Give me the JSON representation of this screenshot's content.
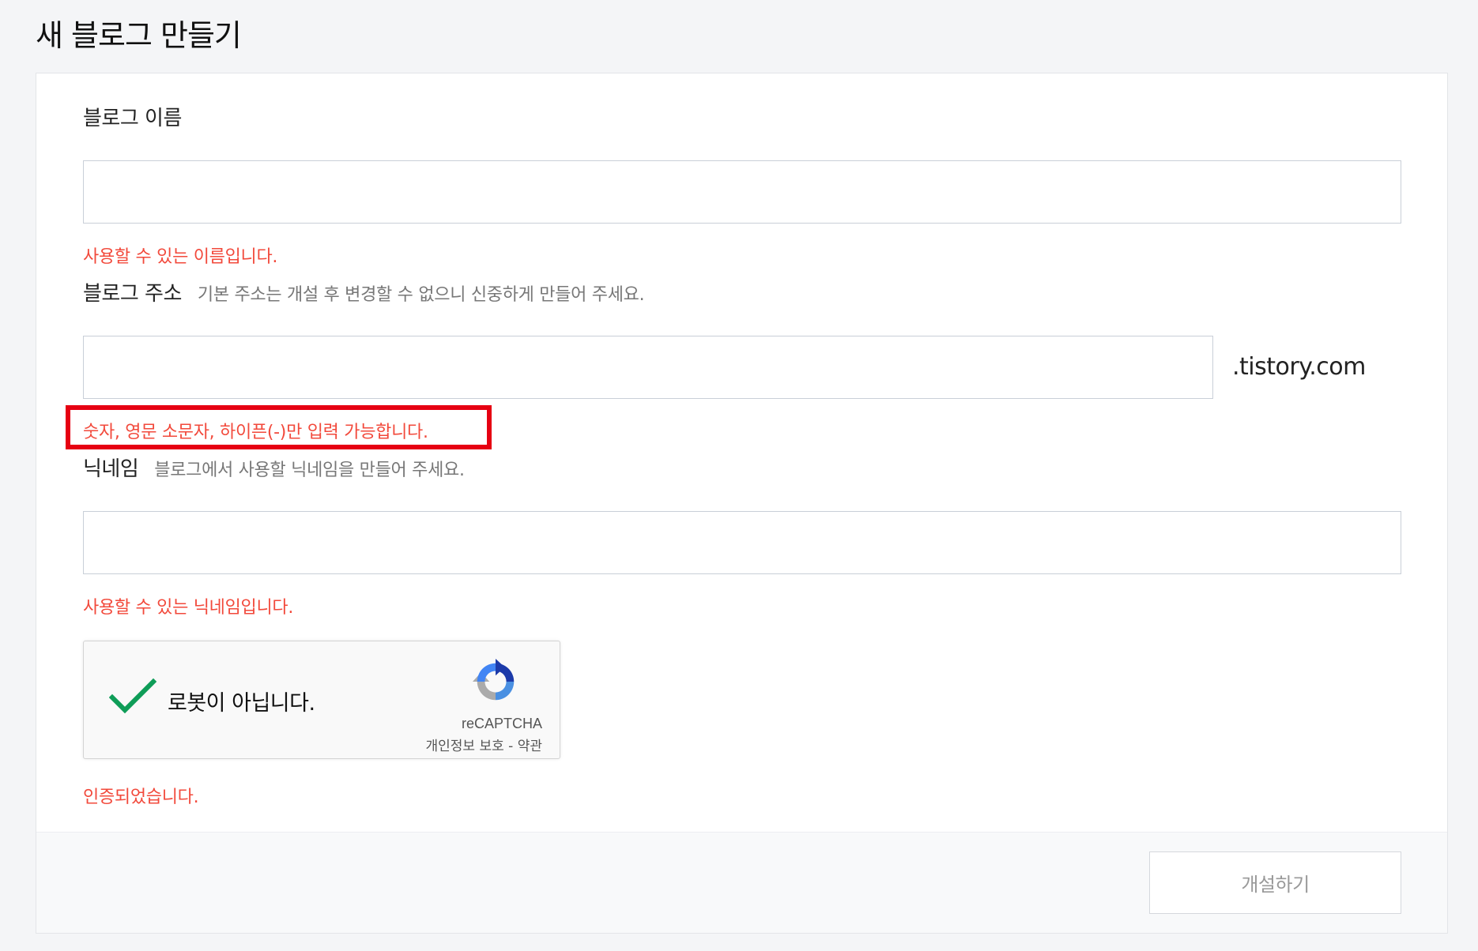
{
  "page": {
    "title": "새 블로그 만들기"
  },
  "form": {
    "blog_name": {
      "label": "블로그 이름",
      "value": "",
      "message": "사용할 수 있는 이름입니다."
    },
    "blog_address": {
      "label": "블로그 주소",
      "hint": "기본 주소는 개설 후 변경할 수 없으니 신중하게 만들어 주세요.",
      "value": "",
      "suffix": ".tistory.com",
      "message": "숫자, 영문 소문자, 하이픈(-)만 입력 가능합니다."
    },
    "nickname": {
      "label": "닉네임",
      "hint": "블로그에서 사용할 닉네임을 만들어 주세요.",
      "value": "",
      "message": "사용할 수 있는 닉네임입니다."
    },
    "captcha": {
      "label": "로봇이 아닙니다.",
      "brand": "reCAPTCHA",
      "privacy_link": "개인정보 보호",
      "separator": " - ",
      "terms_link": "약관",
      "checked": true,
      "message": "인증되었습니다."
    },
    "submit_label": "개설하기"
  },
  "colors": {
    "error_text": "#f2493b",
    "highlight_border": "#e60012",
    "check_green": "#0f9d58",
    "button_text_disabled": "#999999"
  }
}
